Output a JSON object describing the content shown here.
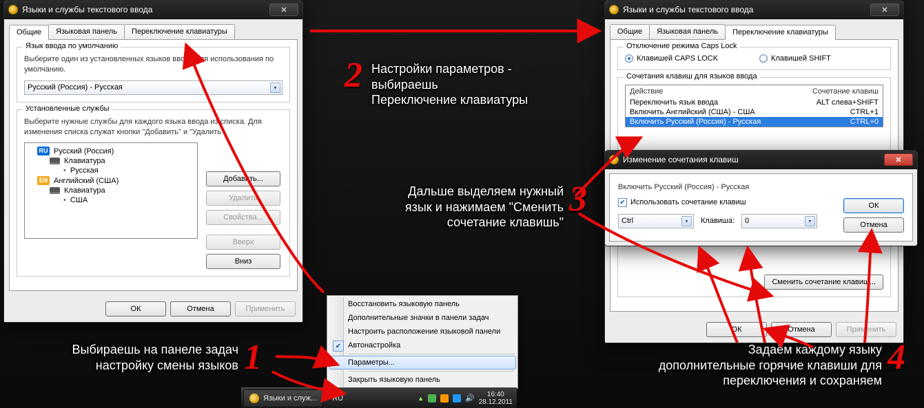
{
  "left_window": {
    "title": "Языки и службы текстового ввода",
    "tabs": {
      "general": "Общие",
      "langbar": "Языковая панель",
      "switch": "Переключение клавиатуры"
    },
    "default_group": {
      "legend": "Язык ввода по умолчанию",
      "desc": "Выберите один из установленных языков ввода для использования по умолчанию.",
      "value": "Русский (Россия) - Русская"
    },
    "services_group": {
      "legend": "Установленные службы",
      "desc": "Выберите нужные службы для каждого языка ввода из списка. Для изменения списка служат кнопки \"Добавить\" и \"Удалить\".",
      "tree": {
        "ru_badge": "RU",
        "ru_lang": "Русский (Россия)",
        "ru_kbd": "Клавиатура",
        "ru_layout": "Русская",
        "en_badge": "EN",
        "en_lang": "Английский (США)",
        "en_kbd": "Клавиатура",
        "en_layout": "США"
      },
      "btn_add": "Добавить...",
      "btn_del": "Удалить",
      "btn_prop": "Свойства...",
      "btn_up": "Вверх",
      "btn_down": "Вниз"
    },
    "footer": {
      "ok": "ОК",
      "cancel": "Отмена",
      "apply": "Применить"
    }
  },
  "right_window": {
    "title": "Языки и службы текстового ввода",
    "tabs": {
      "general": "Общие",
      "langbar": "Языковая панель",
      "switch": "Переключение клавиатуры"
    },
    "caps_group": {
      "legend": "Отключение режима Caps Lock",
      "opt_caps": "Клавишей CAPS LOCK",
      "opt_shift": "Клавишей SHIFT"
    },
    "hotkey_group": {
      "legend": "Сочетания клавиш для языков ввода",
      "col_action": "Действие",
      "col_combo": "Сочетание клавиш",
      "rows": [
        {
          "action": "Переключить язык ввода",
          "combo": "ALT слева+SHIFT"
        },
        {
          "action": "Включить Английский (США) - США",
          "combo": "CTRL+1"
        },
        {
          "action": "Включить Русский (Россия) - Русская",
          "combo": "CTRL+0"
        }
      ],
      "btn_change": "Сменить сочетание клавиш..."
    },
    "footer": {
      "ok": "ОК",
      "cancel": "Отмена",
      "apply": "Применить"
    }
  },
  "change_dialog": {
    "title": "Изменение сочетания клавиш",
    "subject": "Включить Русский (Россия) - Русская",
    "use_combo": "Использовать сочетание клавиш",
    "mod_value": "Ctrl",
    "key_label": "Клавиша:",
    "key_value": "0",
    "ok": "ОК",
    "cancel": "Отмена"
  },
  "context_menu": {
    "items": [
      "Восстановить языковую панель",
      "Дополнительные значки в панели задач",
      "Настроить расположение языковой панели",
      "Автонастройка",
      "Параметры...",
      "Закрыть языковую панель"
    ],
    "checked_index": 3,
    "hl_index": 4
  },
  "taskbar": {
    "btn_label": "Языки и служ...",
    "lang": "RU",
    "time": "16:40",
    "date": "28.12.2011"
  },
  "annotations": {
    "a1": "Выбираешь на панеле задач\nнастройку смены языков",
    "a2": "Настройки параметров -\nвыбираешь\nПереключение клавиатуры",
    "a3": "Дальше выделяем нужный\nязык и  нажимаем \"Сменить\nсочетание клавишь\"",
    "a4": "Задаём каждому языку\nдополнительные горячие клавиши для\nпереключения и сохраняем",
    "n1": "1",
    "n2": "2",
    "n3": "3",
    "n4": "4"
  }
}
